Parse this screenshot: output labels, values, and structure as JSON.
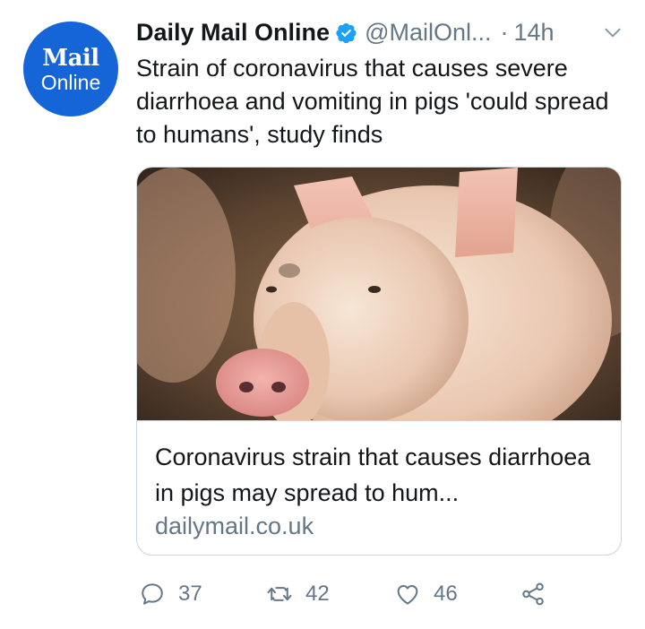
{
  "avatar": {
    "line1": "Mail",
    "line2": "Online",
    "bg_color": "#1565d8"
  },
  "header": {
    "name": "Daily Mail Online",
    "handle": "@MailOnl...",
    "separator": "·",
    "time": "14h"
  },
  "tweet": {
    "text": "Strain of coronavirus that causes severe diarrhoea and vomiting in pigs 'could spread to humans', study finds"
  },
  "card": {
    "image_icon": "pig-photo",
    "title": "Coronavirus strain that causes diarrhoea in pigs may spread to hum...",
    "domain": "dailymail.co.uk"
  },
  "actions": {
    "reply_count": "37",
    "retweet_count": "42",
    "like_count": "46",
    "icons": [
      "reply-icon",
      "retweet-icon",
      "like-icon",
      "share-icon"
    ]
  },
  "colors": {
    "verified": "#1da1f2",
    "secondary_text": "#657786",
    "border": "#ccd6dd"
  }
}
